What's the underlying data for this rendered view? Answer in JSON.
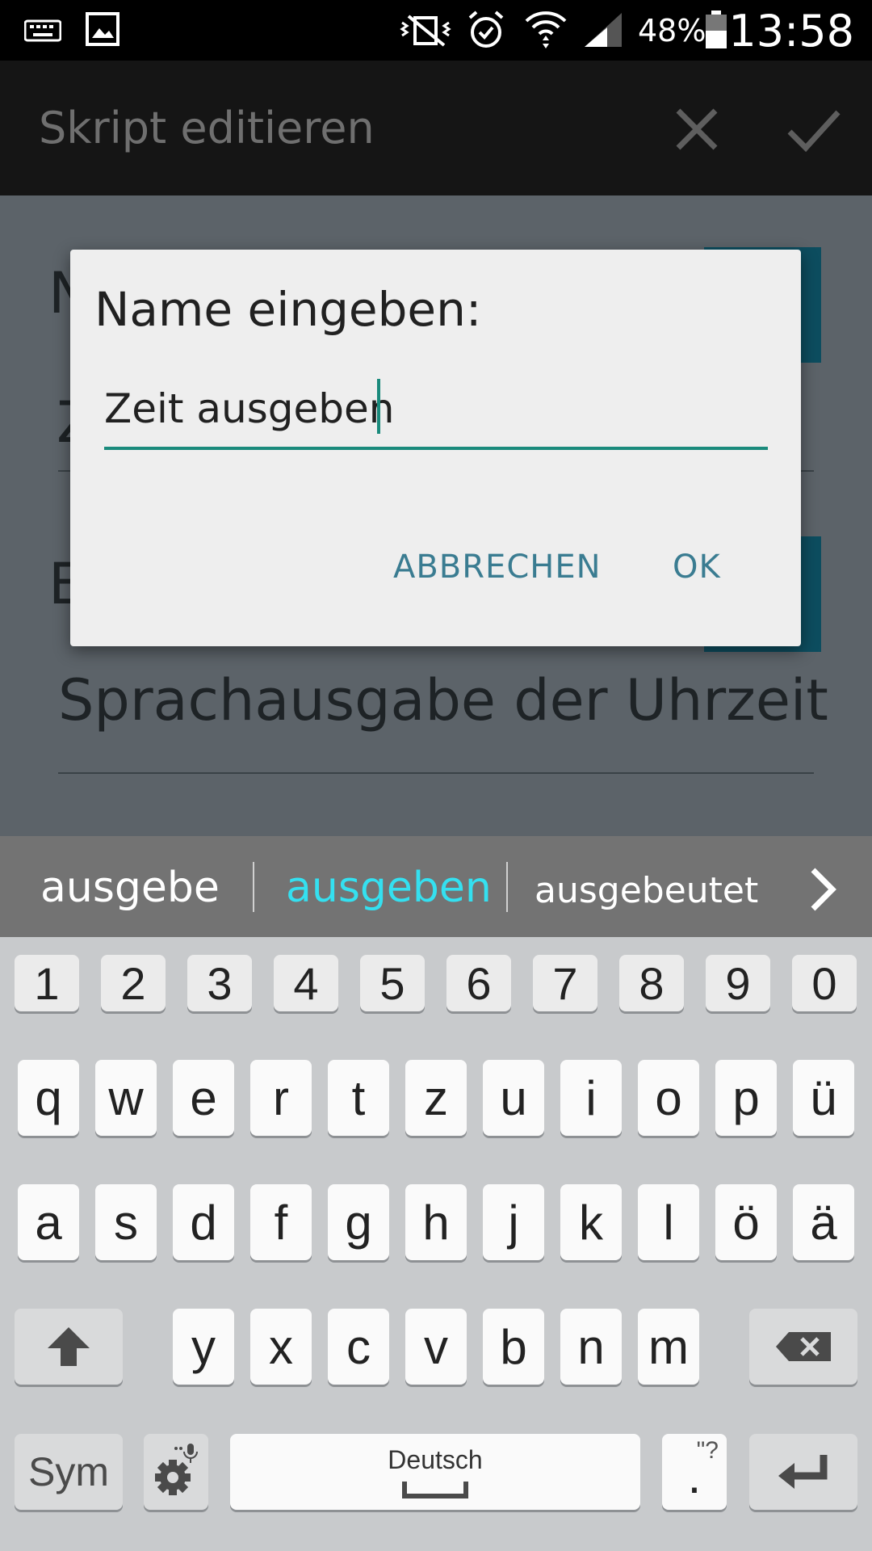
{
  "status_bar": {
    "battery_percent": "48%",
    "time": "13:58"
  },
  "action_bar": {
    "title": "Skript editieren",
    "close_icon": "close-icon",
    "confirm_icon": "check-icon"
  },
  "background": {
    "visible_text": "Sprachausgabe der Uhrzeit"
  },
  "dialog": {
    "title": "Name eingeben:",
    "input_value": "Zeit ausgeben",
    "cancel_label": "ABBRECHEN",
    "ok_label": "OK"
  },
  "suggestions": {
    "items": [
      "ausgebe",
      "ausgeben",
      "ausgebeutet"
    ],
    "highlight_color": "#34e0f0"
  },
  "keyboard": {
    "numbers": [
      "1",
      "2",
      "3",
      "4",
      "5",
      "6",
      "7",
      "8",
      "9",
      "0"
    ],
    "row1": [
      "q",
      "w",
      "e",
      "r",
      "t",
      "z",
      "u",
      "i",
      "o",
      "p",
      "ü"
    ],
    "row2": [
      "a",
      "s",
      "d",
      "f",
      "g",
      "h",
      "j",
      "k",
      "l",
      "ö",
      "ä"
    ],
    "row3": [
      "y",
      "x",
      "c",
      "v",
      "b",
      "n",
      "m"
    ],
    "sym_label": "Sym",
    "space_label": "Deutsch",
    "period_label": ".",
    "punct_hint": "\"?"
  },
  "colors": {
    "accent_teal": "#1a8a7c",
    "button_text": "#3a7c91"
  }
}
